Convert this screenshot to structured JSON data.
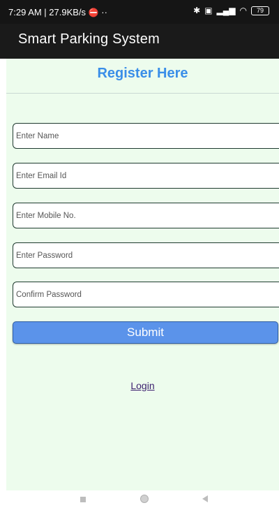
{
  "status_bar": {
    "time_info": "7:29 AM | 27.9KB/s",
    "left_extra": "··",
    "battery": "79"
  },
  "app_bar": {
    "title": "Smart Parking System"
  },
  "form": {
    "heading": "Register Here",
    "fields": [
      {
        "placeholder": "Enter Name"
      },
      {
        "placeholder": "Enter Email Id"
      },
      {
        "placeholder": "Enter Mobile No."
      },
      {
        "placeholder": "Enter Password"
      },
      {
        "placeholder": "Confirm Password"
      }
    ],
    "submit_label": "Submit",
    "login_label": "Login"
  }
}
